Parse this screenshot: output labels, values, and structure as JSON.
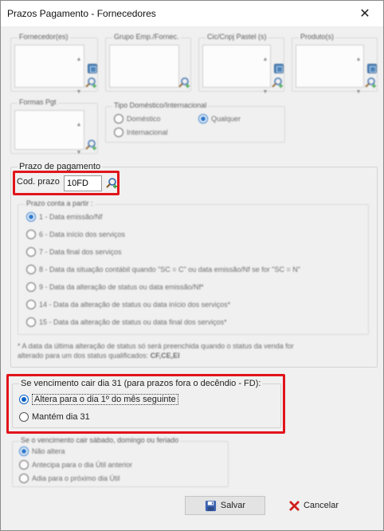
{
  "window": {
    "title": "Prazos Pagamento - Fornecedores",
    "close_glyph": "✕"
  },
  "filters": {
    "fornecedores": "Fornecedor(es)",
    "grupo": "Grupo Emp./Fornec.",
    "cnpj": "Cic/Cnpj Pastel (s)",
    "produtos": "Produto(s)",
    "formas": "Formas Pgt",
    "tipo": {
      "legend": "Tipo Doméstico/Internacional",
      "options": [
        "Doméstico",
        "Internacional",
        "Qualquer"
      ]
    }
  },
  "prazo": {
    "legend": "Prazo de pagamento",
    "cod_label": "Cod. prazo",
    "cod_value": "10FD",
    "conta_legend": "Prazo conta a partir :",
    "options": [
      "1 - Data emissão/Nf",
      "6 - Data início dos serviços",
      "7 - Data final dos serviços",
      "8 - Data da situação contábil quando \"SC = C\" ou data emissão/Nf se for \"SC = N\"",
      "9 - Data da alteração de status ou data emissão/Nf*",
      "14 - Data da alteração de status ou data início dos serviços*",
      "15 - Data da alteração de status ou data final dos serviços*"
    ],
    "note_line1": "* A data da última alteração de status só será preenchida quando o status da venda for",
    "note_line2": "alterado para um dos status qualificados:",
    "note_codes": "CF,CE,EI"
  },
  "dia31": {
    "legend": "Se vencimento cair dia 31 (para prazos fora o decêndio - FD):",
    "opt1": "Altera para o dia 1º do mês seguinte",
    "opt2": "Mantém dia 31"
  },
  "weekend": {
    "legend": "Se o vencimento cair sábado, domingo ou feriado",
    "options": [
      "Não altera",
      "Antecipa para o dia Útil anterior",
      "Adia para o próximo dia Útil"
    ]
  },
  "buttons": {
    "save": "Salvar",
    "cancel": "Cancelar"
  },
  "colors": {
    "highlight": "#e1141b",
    "accent": "#0a62c4"
  }
}
